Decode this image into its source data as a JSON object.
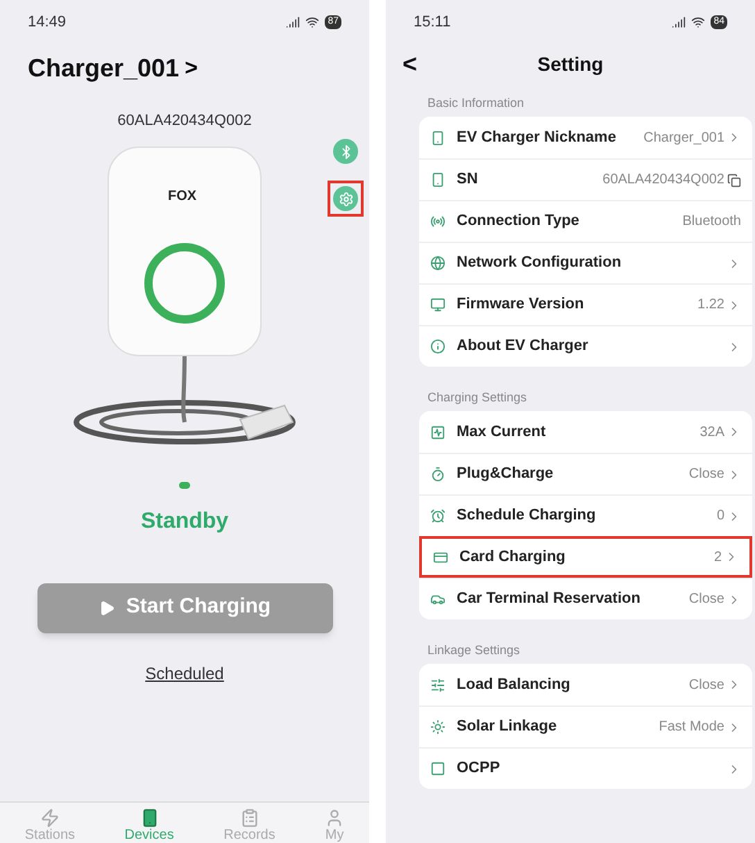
{
  "left_screen": {
    "status_bar": {
      "time": "14:49",
      "battery": "87"
    },
    "title": "Charger_001",
    "title_chevron": ">",
    "serial": "60ALA420434Q002",
    "side_buttons": [
      {
        "kind": "bluetooth",
        "highlighted": false
      },
      {
        "kind": "settings",
        "highlighted": true
      }
    ],
    "charger_logo": "FOX",
    "status": "Standby",
    "start_button": {
      "label": "Start Charging",
      "disabled": true
    },
    "scheduled_link": "Scheduled",
    "tabs": [
      {
        "label": "Stations",
        "selected": false
      },
      {
        "label": "Devices",
        "selected": true
      },
      {
        "label": "Records",
        "selected": false
      },
      {
        "label": "My",
        "selected": false
      }
    ]
  },
  "right_screen": {
    "status_bar": {
      "time": "15:11",
      "battery": "84"
    },
    "header": {
      "back": "<",
      "title": "Setting"
    },
    "sections": [
      {
        "title": "Basic Information",
        "rows": [
          {
            "label": "EV Charger Nickname",
            "value": "Charger_001",
            "chevron": true,
            "highlighted": false
          },
          {
            "label": "SN",
            "value": "60ALA420434Q002",
            "copy": true,
            "highlighted": false
          },
          {
            "label": "Connection Type",
            "value": "Bluetooth",
            "highlighted": false
          },
          {
            "label": "Network Configuration",
            "chevron": true,
            "highlighted": false
          },
          {
            "label": "Firmware Version",
            "value": "1.22",
            "chevron": true,
            "highlighted": false
          },
          {
            "label": "About EV Charger",
            "chevron": true,
            "highlighted": false
          }
        ]
      },
      {
        "title": "Charging Settings",
        "rows": [
          {
            "label": "Max Current",
            "value": "32A",
            "chevron": true,
            "highlighted": false
          },
          {
            "label": "Plug&Charge",
            "value": "Close",
            "chevron": true,
            "highlighted": false
          },
          {
            "label": "Schedule Charging",
            "value": "0",
            "chevron": true,
            "highlighted": false
          },
          {
            "label": "Card Charging",
            "value": "2",
            "chevron": true,
            "highlighted": true
          },
          {
            "label": "Car Terminal Reservation",
            "value": "Close",
            "chevron": true,
            "highlighted": false
          }
        ]
      },
      {
        "title": "Linkage Settings",
        "rows": [
          {
            "label": "Load Balancing",
            "value": "Close",
            "chevron": true,
            "highlighted": false
          },
          {
            "label": "Solar Linkage",
            "value": "Fast Mode",
            "chevron": true,
            "highlighted": false
          },
          {
            "label": "OCPP",
            "chevron": true,
            "highlighted": false
          }
        ]
      }
    ]
  }
}
